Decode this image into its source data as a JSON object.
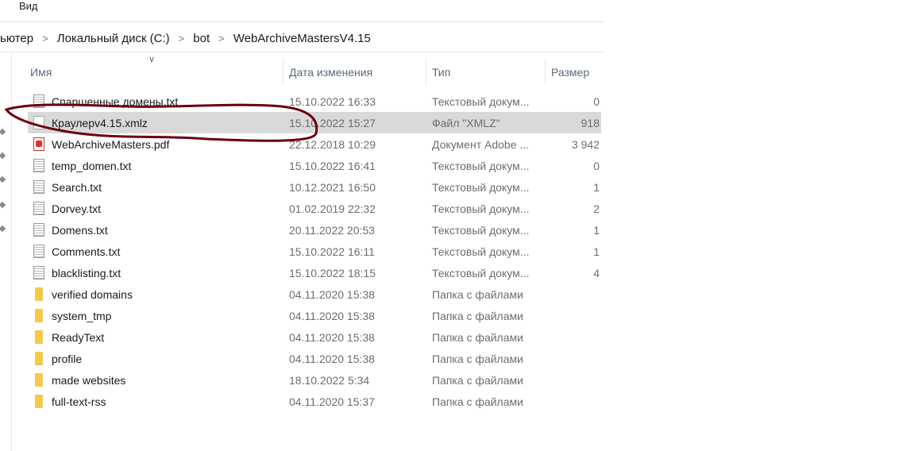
{
  "menu": {
    "view": "Вид"
  },
  "breadcrumb": [
    "ьютер",
    "Локальный диск (C:)",
    "bot",
    "WebArchiveMastersV4.15"
  ],
  "columns": {
    "name": "Имя",
    "date": "Дата изменения",
    "type": "Тип",
    "size": "Размер"
  },
  "files": [
    {
      "name": "Спаршенные домены.txt",
      "date": "15.10.2022 16:33",
      "type": "Текстовый докум...",
      "size": "0",
      "icon": "text-file"
    },
    {
      "name": "Краулерv4.15.xmlz",
      "date": "15.10.2022 15:27",
      "type": "Файл \"XMLZ\"",
      "size": "918",
      "icon": "blank-file",
      "selected": true
    },
    {
      "name": "WebArchiveMasters.pdf",
      "date": "22.12.2018 10:29",
      "type": "Документ Adobe ...",
      "size": "3 942",
      "icon": "pdf-file"
    },
    {
      "name": "temp_domen.txt",
      "date": "15.10.2022 16:41",
      "type": "Текстовый докум...",
      "size": "0",
      "icon": "text-file"
    },
    {
      "name": "Search.txt",
      "date": "10.12.2021 16:50",
      "type": "Текстовый докум...",
      "size": "1",
      "icon": "text-file"
    },
    {
      "name": "Dorvey.txt",
      "date": "01.02.2019 22:32",
      "type": "Текстовый докум...",
      "size": "2",
      "icon": "text-file"
    },
    {
      "name": "Domens.txt",
      "date": "20.11.2022 20:53",
      "type": "Текстовый докум...",
      "size": "1",
      "icon": "text-file"
    },
    {
      "name": "Comments.txt",
      "date": "15.10.2022 16:11",
      "type": "Текстовый докум...",
      "size": "1",
      "icon": "text-file"
    },
    {
      "name": "blacklisting.txt",
      "date": "15.10.2022 18:15",
      "type": "Текстовый докум...",
      "size": "4",
      "icon": "text-file"
    },
    {
      "name": "verified domains",
      "date": "04.11.2020 15:38",
      "type": "Папка с файлами",
      "size": "",
      "icon": "folder"
    },
    {
      "name": "system_tmp",
      "date": "04.11.2020 15:38",
      "type": "Папка с файлами",
      "size": "",
      "icon": "folder"
    },
    {
      "name": "ReadyText",
      "date": "04.11.2020 15:38",
      "type": "Папка с файлами",
      "size": "",
      "icon": "folder"
    },
    {
      "name": "profile",
      "date": "04.11.2020 15:38",
      "type": "Папка с файлами",
      "size": "",
      "icon": "folder"
    },
    {
      "name": "made websites",
      "date": "18.10.2022 5:34",
      "type": "Папка с файлами",
      "size": "",
      "icon": "folder"
    },
    {
      "name": "full-text-rss",
      "date": "04.11.2020 15:37",
      "type": "Папка с файлами",
      "size": "",
      "icon": "folder"
    }
  ],
  "colors": {
    "selection": "#d9d9d9",
    "annotation": "#6b0010"
  }
}
